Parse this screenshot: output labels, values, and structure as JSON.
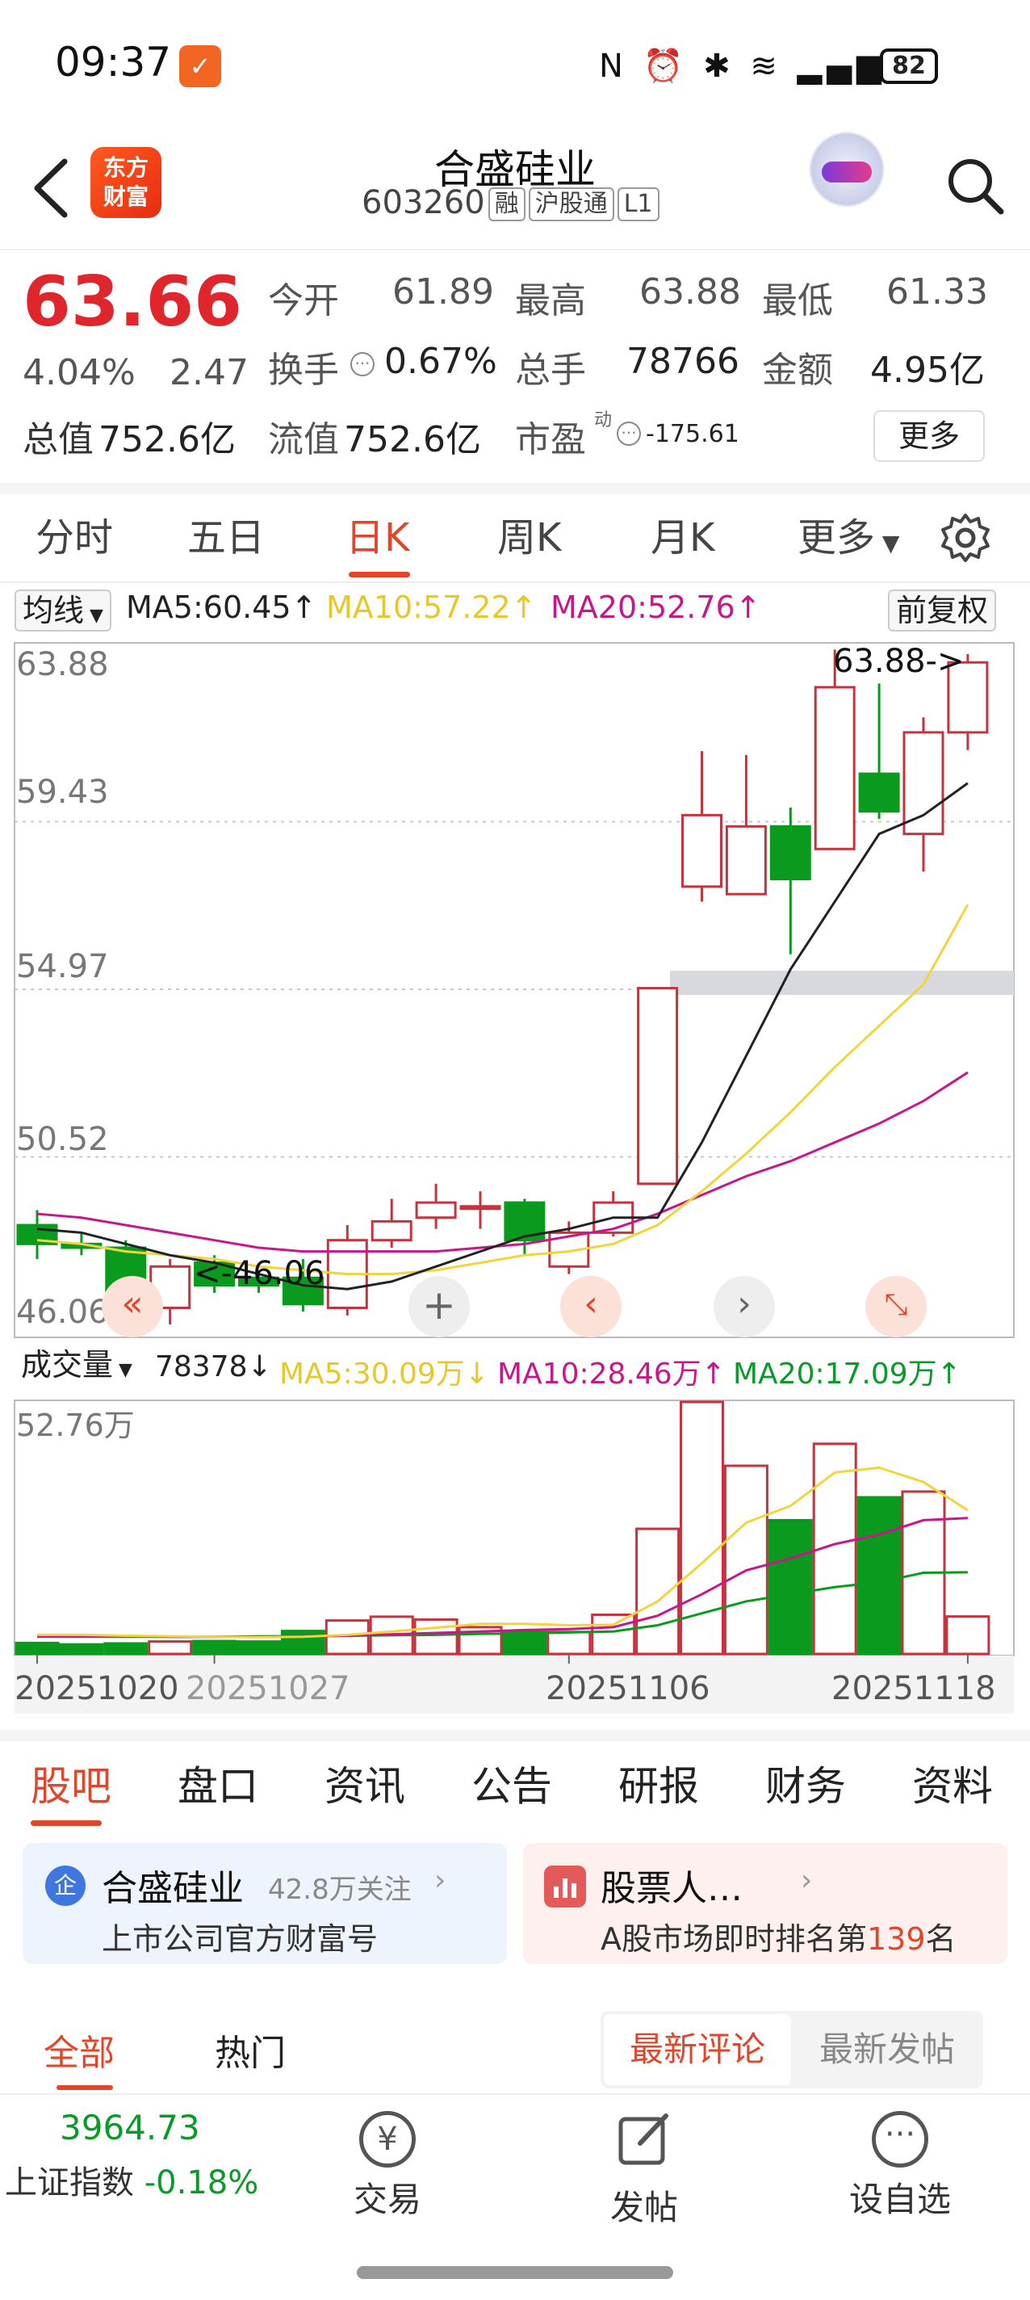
{
  "status": {
    "time": "09:37",
    "battery": "82",
    "icons": "N ⏰ ✱ ≋ ▂▄▆"
  },
  "header": {
    "logo_line1": "东方",
    "logo_line2": "财富",
    "name": "合盛硅业",
    "code": "603260",
    "tags": [
      "融",
      "沪股通",
      "L1"
    ]
  },
  "quote": {
    "price": "63.66",
    "change_pct": "4.04%",
    "change": "2.47",
    "total_value_label": "总值",
    "total_value": "752.6亿",
    "open_label": "今开",
    "open": "61.89",
    "high_label": "最高",
    "high": "63.88",
    "low_label": "最低",
    "low": "61.33",
    "turnover_label": "换手",
    "turnover": "0.67%",
    "volume_label": "总手",
    "volume": "78766",
    "amount_label": "金额",
    "amount": "4.95亿",
    "float_value_label": "流值",
    "float_value": "752.6亿",
    "pe_label": "市盈",
    "pe_sup": "动",
    "pe": "-175.61",
    "more": "更多"
  },
  "chart_tabs": [
    "分时",
    "五日",
    "日K",
    "周K",
    "月K",
    "更多"
  ],
  "chart_tab_active": "日K",
  "ma_bar": {
    "label": "均线",
    "ma5": "MA5:60.45↑",
    "ma10": "MA10:57.22↑",
    "ma20": "MA20:52.76↑",
    "adjust": "前复权"
  },
  "price_axis": [
    "63.88",
    "59.43",
    "54.97",
    "50.52",
    "46.06"
  ],
  "high_marker": "63.88->",
  "low_marker": "<-46.06",
  "vol_bar": {
    "label": "成交量",
    "value": "78378↓",
    "ma5": "MA5:30.09万↓",
    "ma10": "MA10:28.46万↑",
    "ma20": "MA20:17.09万↑",
    "axis_max": "52.76万"
  },
  "dates": [
    "20251020",
    "20251027",
    "20251106",
    "20251118"
  ],
  "colors": {
    "up": "#c8323c",
    "down": "#0a9a1e",
    "ma5": "#222222",
    "ma10": "#f2d43c",
    "ma20": "#c8168c",
    "accent": "#e2462a"
  },
  "chart_data": {
    "type": "candlestick",
    "y_range": [
      46.06,
      63.88
    ],
    "candles": [
      {
        "o": 48.7,
        "c": 48.2,
        "h": 49.1,
        "l": 47.8
      },
      {
        "o": 48.2,
        "c": 48.1,
        "h": 48.5,
        "l": 47.9
      },
      {
        "o": 48.1,
        "c": 46.9,
        "h": 48.3,
        "l": 46.7
      },
      {
        "o": 46.5,
        "c": 47.6,
        "h": 47.8,
        "l": 46.06
      },
      {
        "o": 47.7,
        "c": 47.1,
        "h": 47.9,
        "l": 46.9
      },
      {
        "o": 47.3,
        "c": 47.1,
        "h": 47.5,
        "l": 46.9
      },
      {
        "o": 47.3,
        "c": 46.6,
        "h": 47.8,
        "l": 46.4
      },
      {
        "o": 46.5,
        "c": 48.3,
        "h": 48.7,
        "l": 46.3
      },
      {
        "o": 48.3,
        "c": 48.8,
        "h": 49.4,
        "l": 48.1
      },
      {
        "o": 48.9,
        "c": 49.3,
        "h": 49.8,
        "l": 48.6
      },
      {
        "o": 49.2,
        "c": 49.2,
        "h": 49.6,
        "l": 48.6
      },
      {
        "o": 49.3,
        "c": 48.3,
        "h": 49.4,
        "l": 47.9
      },
      {
        "o": 47.6,
        "c": 48.5,
        "h": 48.8,
        "l": 47.4
      },
      {
        "o": 48.5,
        "c": 49.3,
        "h": 49.6,
        "l": 48.4
      },
      {
        "o": 49.8,
        "c": 55.0,
        "h": 55.0,
        "l": 49.8
      },
      {
        "o": 57.7,
        "c": 59.6,
        "h": 61.3,
        "l": 57.3
      },
      {
        "o": 57.5,
        "c": 59.3,
        "h": 61.2,
        "l": 57.5
      },
      {
        "o": 59.3,
        "c": 57.9,
        "h": 59.8,
        "l": 55.9
      },
      {
        "o": 58.7,
        "c": 63.0,
        "h": 64.0,
        "l": 58.7
      },
      {
        "o": 60.7,
        "c": 59.7,
        "h": 63.1,
        "l": 59.5
      },
      {
        "o": 59.1,
        "c": 61.8,
        "h": 62.2,
        "l": 58.1
      },
      {
        "o": 61.8,
        "c": 63.66,
        "h": 63.88,
        "l": 61.33
      }
    ],
    "ma5": [
      48.6,
      48.5,
      48.2,
      47.9,
      47.7,
      47.4,
      47.1,
      47.0,
      47.2,
      47.6,
      48.0,
      48.4,
      48.6,
      48.9,
      48.9,
      50.9,
      53.2,
      55.5,
      57.3,
      59.1,
      59.6,
      60.45
    ],
    "ma10": [
      48.3,
      48.2,
      48.0,
      47.9,
      47.8,
      47.6,
      47.5,
      47.4,
      47.4,
      47.5,
      47.7,
      47.9,
      48.0,
      48.2,
      48.7,
      49.6,
      50.6,
      51.7,
      52.9,
      54.0,
      55.1,
      57.22
    ],
    "ma20": [
      49.0,
      48.9,
      48.7,
      48.5,
      48.3,
      48.1,
      48.0,
      48.0,
      48.0,
      48.0,
      48.1,
      48.2,
      48.4,
      48.6,
      49.0,
      49.5,
      50.0,
      50.4,
      50.9,
      51.4,
      52.0,
      52.76
    ],
    "volume_max_wan": 52.76,
    "volumes_wan": [
      2.3,
      2.0,
      2.2,
      2.6,
      2.7,
      2.6,
      4.8,
      7.0,
      7.8,
      7.2,
      5.6,
      4.6,
      4.6,
      8.2,
      26.2,
      52.76,
      39.4,
      28.0,
      44.0,
      32.8,
      34.0,
      7.84
    ],
    "volume_ma5": [
      4.0,
      4.0,
      3.8,
      3.7,
      3.6,
      3.5,
      3.6,
      4.0,
      4.7,
      5.5,
      6.3,
      6.3,
      6.0,
      6.1,
      11.0,
      19.0,
      27.5,
      31.0,
      38.0,
      39.0,
      36.0,
      30.09
    ],
    "volume_ma10": [
      3.8,
      3.8,
      3.7,
      3.6,
      3.6,
      3.6,
      3.7,
      3.8,
      4.1,
      4.4,
      4.7,
      5.0,
      5.2,
      5.6,
      8.0,
      12.5,
      17.5,
      20.0,
      23.0,
      25.0,
      28.0,
      28.46
    ],
    "volume_ma20": [
      3.6,
      3.6,
      3.6,
      3.6,
      3.6,
      3.7,
      3.7,
      3.8,
      3.9,
      4.0,
      4.2,
      4.3,
      4.5,
      4.7,
      6.0,
      8.5,
      11.0,
      12.5,
      14.0,
      15.0,
      17.0,
      17.09
    ]
  },
  "bottom_tabs": [
    "股吧",
    "盘口",
    "资讯",
    "公告",
    "研报",
    "财务",
    "资料"
  ],
  "card1": {
    "badge": "企",
    "title": "合盛硅业",
    "follow": "42.8万关注",
    "subtitle": "上市公司官方财富号"
  },
  "card2": {
    "title": "股票人…",
    "sub_prefix": "A股市场即时排名第",
    "rank": "139",
    "sub_suffix": "名"
  },
  "feed_tabs": {
    "all": "全部",
    "hot": "热门",
    "latest_comment": "最新评论",
    "latest_post": "最新发帖"
  },
  "bottom_nav": {
    "index_value": "3964.73",
    "index_label": "上证指数",
    "index_change": "-0.18%",
    "trade": "交易",
    "post": "发帖",
    "watch": "设自选"
  }
}
